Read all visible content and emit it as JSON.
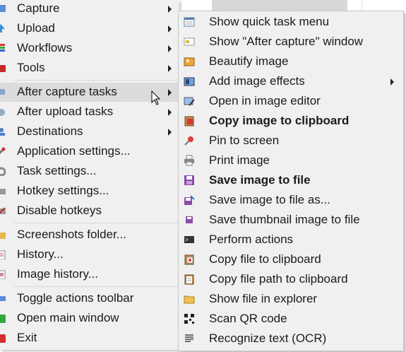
{
  "main_menu": {
    "items": [
      {
        "label": "Capture",
        "icon": "capture-icon",
        "submenu": true
      },
      {
        "label": "Upload",
        "icon": "upload-icon",
        "submenu": true
      },
      {
        "label": "Workflows",
        "icon": "workflows-icon",
        "submenu": true
      },
      {
        "label": "Tools",
        "icon": "tools-icon",
        "submenu": true
      },
      {
        "label": "After capture tasks",
        "icon": "after-capture-icon",
        "submenu": true,
        "highlighted": true
      },
      {
        "label": "After upload tasks",
        "icon": "after-upload-icon",
        "submenu": true
      },
      {
        "label": "Destinations",
        "icon": "destinations-icon",
        "submenu": true
      },
      {
        "label": "Application settings...",
        "icon": "wrench-icon",
        "submenu": false
      },
      {
        "label": "Task settings...",
        "icon": "gear-icon",
        "submenu": false
      },
      {
        "label": "Hotkey settings...",
        "icon": "keyboard-icon",
        "submenu": false
      },
      {
        "label": "Disable hotkeys",
        "icon": "disable-keyboard-icon",
        "submenu": false
      },
      {
        "label": "Screenshots folder...",
        "icon": "folder-icon",
        "submenu": false
      },
      {
        "label": "History...",
        "icon": "history-icon",
        "submenu": false
      },
      {
        "label": "Image history...",
        "icon": "image-history-icon",
        "submenu": false
      },
      {
        "label": "Toggle actions toolbar",
        "icon": "toolbar-icon",
        "submenu": false
      },
      {
        "label": "Open main window",
        "icon": "window-icon",
        "submenu": false
      },
      {
        "label": "Exit",
        "icon": "exit-icon",
        "submenu": false
      }
    ]
  },
  "sub_menu": {
    "items": [
      {
        "label": "Show quick task menu",
        "icon": "quick-task-menu-icon",
        "bold": false
      },
      {
        "label": "Show \"After capture\" window",
        "icon": "after-capture-window-icon",
        "bold": false
      },
      {
        "label": "Beautify image",
        "icon": "beautify-icon",
        "bold": false
      },
      {
        "label": "Add image effects",
        "icon": "image-effects-icon",
        "bold": false,
        "submenu": true
      },
      {
        "label": "Open in image editor",
        "icon": "image-editor-icon",
        "bold": false
      },
      {
        "label": "Copy image to clipboard",
        "icon": "clipboard-image-icon",
        "bold": true
      },
      {
        "label": "Pin to screen",
        "icon": "pin-icon",
        "bold": false
      },
      {
        "label": "Print image",
        "icon": "printer-icon",
        "bold": false
      },
      {
        "label": "Save image to file",
        "icon": "save-icon",
        "bold": true
      },
      {
        "label": "Save image to file as...",
        "icon": "save-as-icon",
        "bold": false
      },
      {
        "label": "Save thumbnail image to file",
        "icon": "save-thumbnail-icon",
        "bold": false
      },
      {
        "label": "Perform actions",
        "icon": "terminal-icon",
        "bold": false
      },
      {
        "label": "Copy file to clipboard",
        "icon": "copy-file-icon",
        "bold": false
      },
      {
        "label": "Copy file path to clipboard",
        "icon": "copy-path-icon",
        "bold": false
      },
      {
        "label": "Show file in explorer",
        "icon": "explorer-folder-icon",
        "bold": false
      },
      {
        "label": "Scan QR code",
        "icon": "qr-code-icon",
        "bold": false
      },
      {
        "label": "Recognize text (OCR)",
        "icon": "ocr-text-icon",
        "bold": false
      }
    ]
  },
  "colors": {
    "menu_bg": "#f0f0f0",
    "highlight": "#dcdcdc",
    "separator": "#d6d6d6",
    "text": "#1b1b1b"
  }
}
